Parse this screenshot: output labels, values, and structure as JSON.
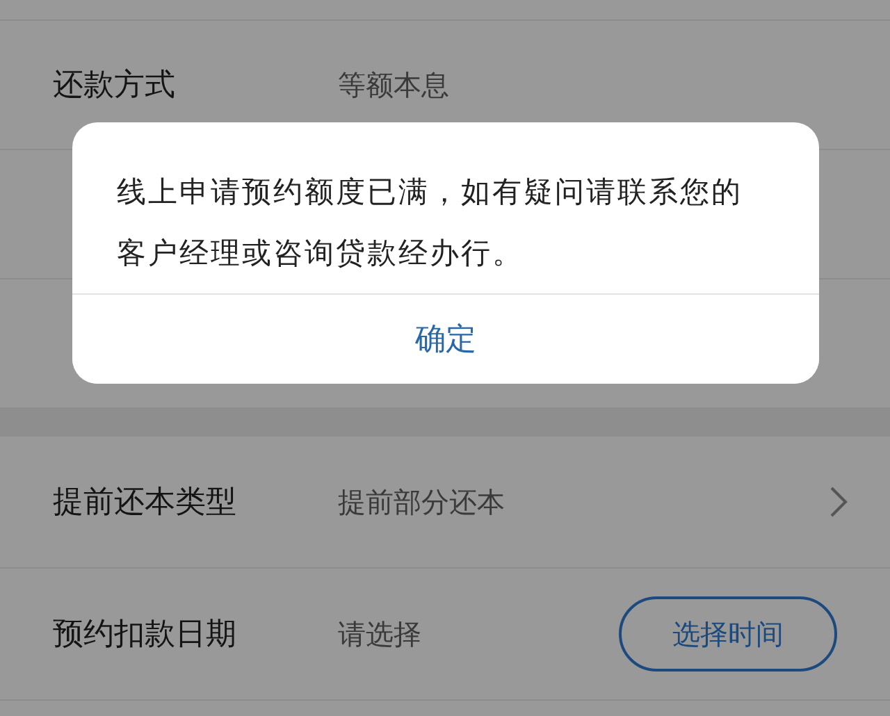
{
  "form": {
    "rows": [
      {
        "kind": "gap"
      },
      {
        "kind": "text",
        "label": "还款方式",
        "value": "等额本息"
      },
      {
        "kind": "gap"
      },
      {
        "kind": "gap"
      },
      {
        "kind": "section"
      },
      {
        "kind": "select",
        "label": "提前还本类型",
        "value": "提前部分还本"
      },
      {
        "kind": "button",
        "label": "预约扣款日期",
        "value": "请选择",
        "button": "选择时间"
      }
    ]
  },
  "dialog": {
    "message": "线上申请预约额度已满，如有疑问请联系您的客户经理或咨询贷款经办行。",
    "confirm": "确定"
  }
}
